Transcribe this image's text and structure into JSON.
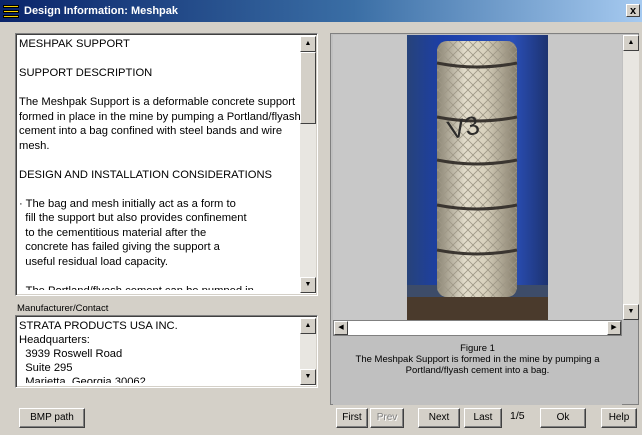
{
  "window": {
    "title": "Design Information: Meshpak",
    "close_glyph": "x"
  },
  "description": {
    "text": "MESHPAK SUPPORT\n\nSUPPORT DESCRIPTION\n\nThe Meshpak Support is a deformable concrete support formed in place in the mine by pumping a Portland/flyash cement into a bag confined with steel bands and wire mesh.\n\nDESIGN AND INSTALLATION CONSIDERATIONS\n\n· The bag and mesh initially act as a form to\n  fill the support but also provides confinement\n  to the cementitious material after the\n  concrete has failed giving the support a\n  useful residual load capacity.\n\n· The Portland/flyash cement can be pumped in"
  },
  "manufacturer": {
    "label": "Manufacturer/Contact",
    "text": "STRATA PRODUCTS USA INC.\nHeadquarters:\n  3939 Roswell Road\n  Suite 295\n  Marietta, Georgia 30062"
  },
  "figure": {
    "caption_title": "Figure 1",
    "caption_text": "The Meshpak Support is formed in the mine by pumping a Portland/flyash cement into a bag.",
    "marking": "V3"
  },
  "buttons": {
    "bmp_path": "BMP path",
    "first": "First",
    "prev": "Prev",
    "next": "Next",
    "last": "Last",
    "ok": "Ok",
    "help": "Help"
  },
  "pager": {
    "text": "1/5"
  }
}
